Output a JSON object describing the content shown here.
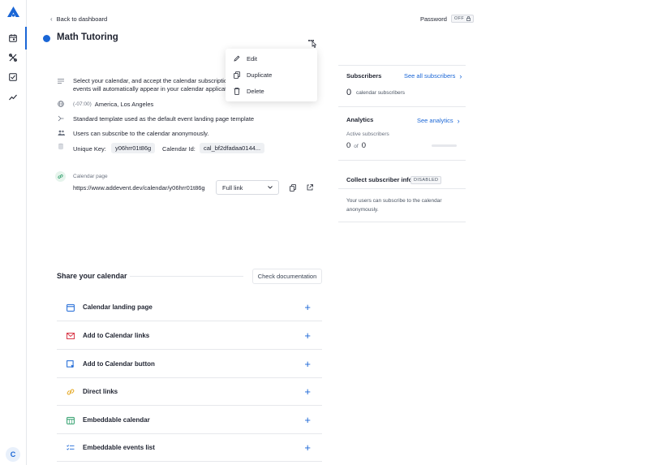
{
  "header": {
    "back_label": "Back to dashboard",
    "password_label": "Password",
    "password_state": "OFF",
    "calendar_title": "Math Tutoring"
  },
  "menu": {
    "items": [
      {
        "label": "Edit",
        "icon": "pencil-icon"
      },
      {
        "label": "Duplicate",
        "icon": "copy-icon"
      },
      {
        "label": "Delete",
        "icon": "trash-icon"
      }
    ]
  },
  "details": {
    "description": "Select your calendar, and accept the calendar subscription... events will automatically appear in your calendar applicati...",
    "description_line1": "Select your calendar, and accept the calendar subscription",
    "description_line2": "events will automatically appear in your calendar applicatio",
    "timezone_offset": "(-07:00)",
    "timezone_name": "America, Los Angeles",
    "template_text": "Standard template used as the default event landing page template",
    "anonymous_text": "Users can subscribe to the calendar anonymously.",
    "unique_key_label": "Unique Key:",
    "unique_key_value": "y06hrr01t86g",
    "calendar_id_label": "Calendar Id:",
    "calendar_id_value": "cal_bf2dfadaa0144..."
  },
  "calendar_page": {
    "label": "Calendar page",
    "url": "https://www.addevent.dev/calendar/y06hrr01t86g",
    "link_type": "Full link"
  },
  "subscribers": {
    "title": "Subscribers",
    "see_all": "See all subscribers",
    "count": "0",
    "count_label": "calendar subscribers"
  },
  "analytics": {
    "title": "Analytics",
    "see": "See analytics",
    "active_label": "Active subscribers",
    "active_value": "0",
    "of_label": "of",
    "total_value": "0",
    "progress": 0
  },
  "collect": {
    "title": "Collect subscriber info",
    "status": "DISABLED",
    "desc_line1": "Your users can subscribe to the calendar",
    "desc_line2": "anonymously."
  },
  "share": {
    "title": "Share your calendar",
    "docs_button": "Check documentation",
    "rows": [
      {
        "label": "Calendar landing page",
        "icon": "calendar-icon",
        "color": "#1a66d6"
      },
      {
        "label": "Add to Calendar links",
        "icon": "mail-icon",
        "color": "#d93a4a"
      },
      {
        "label": "Add to Calendar button",
        "icon": "cursor-box-icon",
        "color": "#1a66d6"
      },
      {
        "label": "Direct links",
        "icon": "link-icon",
        "color": "#e5a823"
      },
      {
        "label": "Embeddable calendar",
        "icon": "calendar-grid-icon",
        "color": "#2e9e6b"
      },
      {
        "label": "Embeddable events list",
        "icon": "list-check-icon",
        "color": "#1a66d6"
      }
    ]
  },
  "user": {
    "avatar_letter": "C"
  },
  "colors": {
    "accent": "#1a66d6",
    "text": "#1f2330"
  }
}
